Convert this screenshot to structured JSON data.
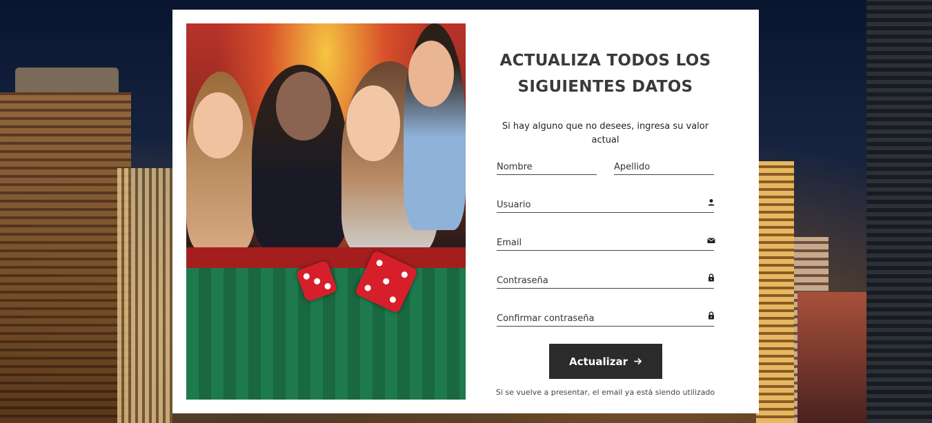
{
  "form": {
    "title": "ACTUALIZA TODOS LOS SIGUIENTES DATOS",
    "subtitle": "Si hay alguno que no desees, ingresa su valor actual",
    "fields": {
      "nombre": {
        "placeholder": "Nombre",
        "value": ""
      },
      "apellido": {
        "placeholder": "Apellido",
        "value": ""
      },
      "usuario": {
        "placeholder": "Usuario",
        "value": "",
        "icon": "user-icon"
      },
      "email": {
        "placeholder": "Email",
        "value": "",
        "icon": "envelope-icon"
      },
      "contrasena": {
        "placeholder": "Contraseña",
        "value": "",
        "icon": "lock-icon"
      },
      "confirmar": {
        "placeholder": "Confirmar contraseña",
        "value": "",
        "icon": "lock-icon"
      }
    },
    "submit_label": "Actualizar",
    "submit_icon": "arrow-right-icon",
    "note": "Si se vuelve a presentar, el email ya está siendo utilizado"
  },
  "colors": {
    "button_bg": "#2b2b2b",
    "card_bg": "#ffffff",
    "text": "#3a3a3a"
  }
}
